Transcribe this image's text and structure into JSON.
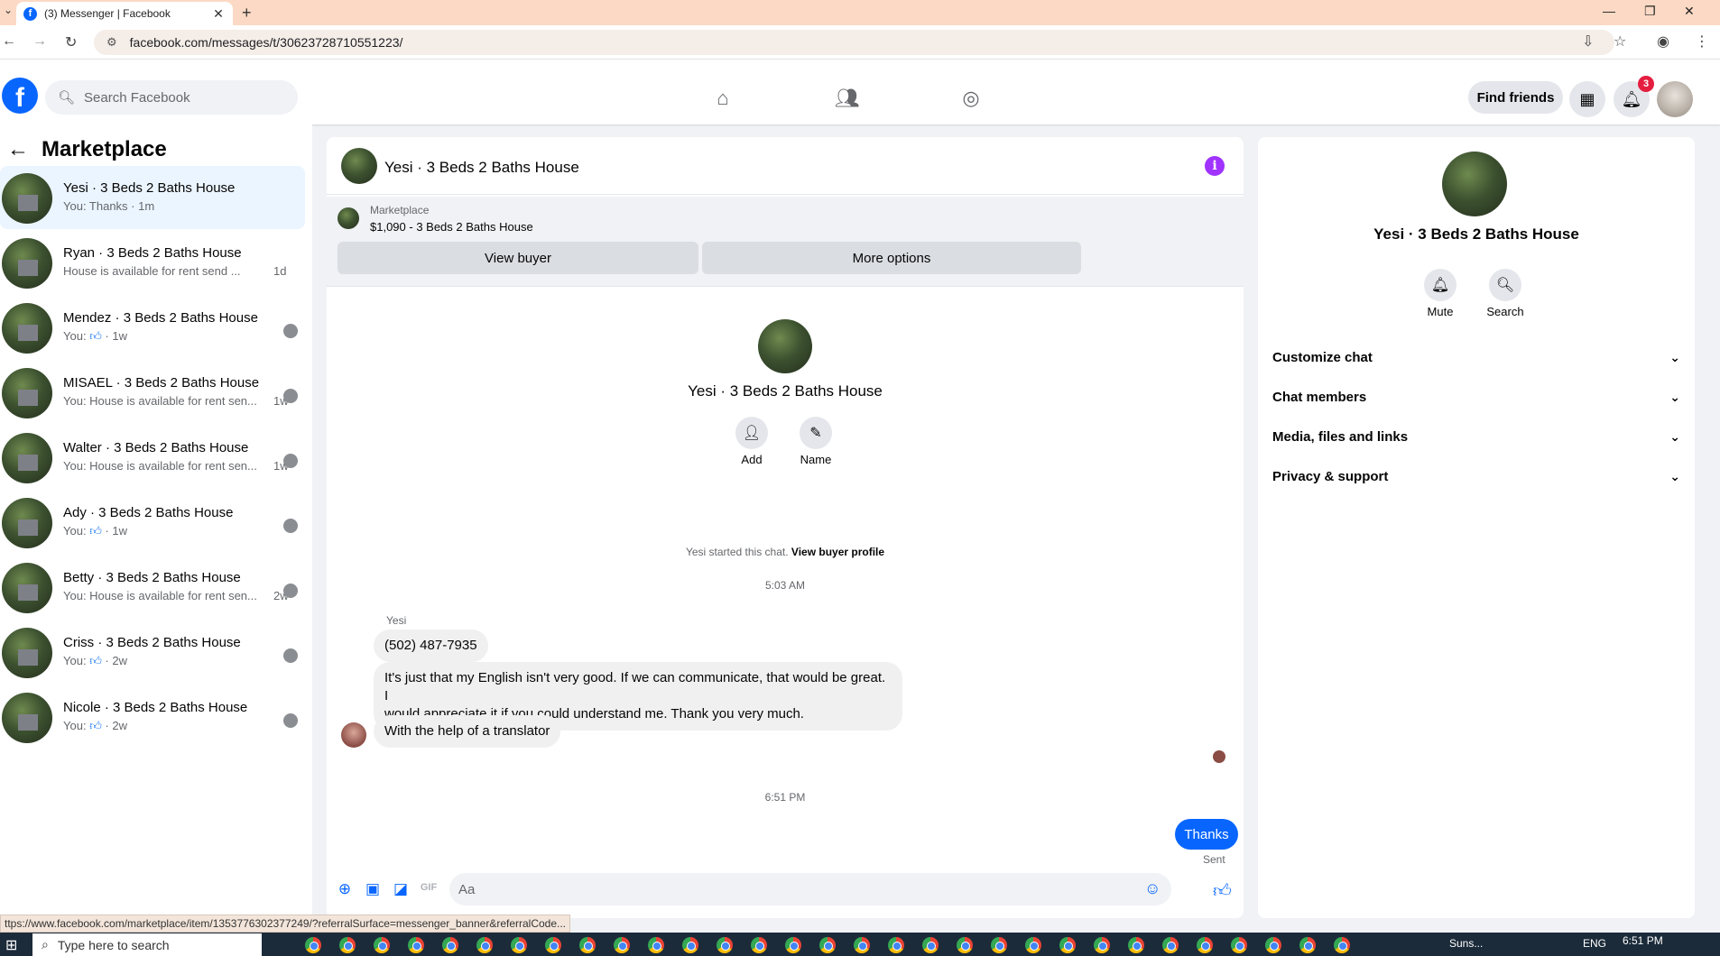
{
  "browser": {
    "tab_title": "(3) Messenger | Facebook",
    "url": "facebook.com/messages/t/30623728710551223/",
    "status_url": "ttps://www.facebook.com/marketplace/item/1353776302377249/?referralSurface=messenger_banner&referralCode..."
  },
  "topnav": {
    "search_placeholder": "Search Facebook",
    "find_friends": "Find friends",
    "notification_count": "3"
  },
  "sidebar": {
    "title": "Marketplace",
    "conversations": [
      {
        "name": "Yesi · 3 Beds 2 Baths House",
        "preview": "You: Thanks · 1m",
        "time": ""
      },
      {
        "name": "Ryan · 3 Beds 2 Baths House",
        "preview": "House is available for rent send ...",
        "time": "1d"
      },
      {
        "name": "Mendez · 3 Beds 2 Baths House",
        "preview": "You:",
        "time": "· 1w"
      },
      {
        "name": "MISAEL · 3 Beds 2 Baths House",
        "preview": "You: House is available for rent sen...",
        "time": "1w"
      },
      {
        "name": "Walter · 3 Beds 2 Baths House",
        "preview": "You: House is available for rent sen...",
        "time": "1w"
      },
      {
        "name": "Ady · 3 Beds 2 Baths House",
        "preview": "You:",
        "time": "· 1w"
      },
      {
        "name": "Betty · 3 Beds 2 Baths House",
        "preview": "You: House is available for rent sen...",
        "time": "2w"
      },
      {
        "name": "Criss · 3 Beds 2 Baths House",
        "preview": "You:",
        "time": "· 2w"
      },
      {
        "name": "Nicole · 3 Beds 2 Baths House",
        "preview": "You:",
        "time": "· 2w"
      }
    ]
  },
  "chat": {
    "title": "Yesi · 3 Beds 2 Baths House",
    "banner_label": "Marketplace",
    "banner_listing": "$1,090 - 3 Beds 2 Baths House",
    "view_buyer": "View buyer",
    "more_options": "More options",
    "intro_name": "Yesi · 3 Beds 2 Baths House",
    "add_label": "Add",
    "name_label": "Name",
    "started_text": "Yesi started this chat.",
    "view_buyer_profile": "View buyer profile",
    "time1": "5:03 AM",
    "sender": "Yesi",
    "msg1": "(502) 487-7935",
    "msg2_line1": "It's just that my English isn't very good. If we can communicate, that would be great. I",
    "msg2_line2": "would appreciate it if you could understand me. Thank you very much.",
    "msg3": "With the help of a translator",
    "time2": "6:51 PM",
    "my_msg": "Thanks",
    "sent_label": "Sent",
    "composer_placeholder": "Aa"
  },
  "info_panel": {
    "name": "Yesi · 3 Beds 2 Baths House",
    "mute": "Mute",
    "search": "Search",
    "sections": [
      "Customize chat",
      "Chat members",
      "Media, files and links",
      "Privacy & support"
    ]
  },
  "taskbar": {
    "search_placeholder": "Type here to search",
    "weather": "Suns...",
    "lang": "ENG",
    "clock": "6:51 PM"
  },
  "colors": {
    "fb_blue": "#0866ff",
    "active_row": "#ebf5ff",
    "info_purple": "#a033ff",
    "badge_red": "#e41e3f"
  }
}
